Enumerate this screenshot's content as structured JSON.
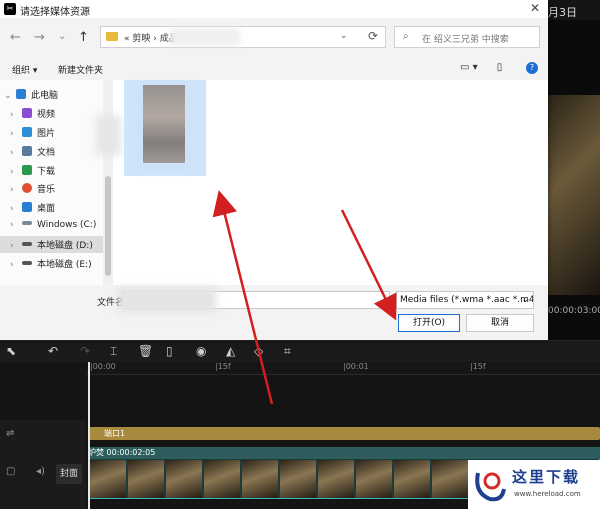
{
  "editor": {
    "date_label": "月3日",
    "timecode": "00:00:03:00",
    "ruler_ticks": [
      "|00:00",
      "|15f",
      "|00:01",
      "|15f"
    ],
    "text_clip_label": "端口1",
    "video_clip_label": "炉焚  00:00:02:05",
    "cover_label": "封面",
    "toolbar_icons": [
      "select-icon",
      "undo-icon",
      "redo-icon",
      "split-icon",
      "delete-icon",
      "crop-frame-icon",
      "play-circle-icon",
      "mirror-icon",
      "rotate-icon",
      "crop-icon"
    ]
  },
  "watermark": {
    "title": "这里下载",
    "url": "www.hereload.com"
  },
  "dialog": {
    "title": "请选择媒体资源",
    "close": "✕",
    "nav": {
      "back": "←",
      "forward": "→",
      "dropdown": "⌄",
      "up": "↑"
    },
    "breadcrumb": "«  剪映  ›  成品",
    "address_dropdown": "⌄",
    "refresh": "⟳",
    "search_placeholder": "在 绍义三兄弟 中搜索",
    "organize": "组织 ▾",
    "new_folder": "新建文件夹",
    "sidebar": [
      {
        "label": "此电脑",
        "chev": "⌄",
        "color": "#2a7fd4"
      },
      {
        "label": "视频",
        "chev": "›",
        "color": "#8a4fd1"
      },
      {
        "label": "图片",
        "chev": "›",
        "color": "#2a8fd4"
      },
      {
        "label": "文档",
        "chev": "›",
        "color": "#5a7a9a"
      },
      {
        "label": "下载",
        "chev": "›",
        "color": "#2a9a4a"
      },
      {
        "label": "音乐",
        "chev": "›",
        "color": "#e05030"
      },
      {
        "label": "桌面",
        "chev": "›",
        "color": "#2a7fd4"
      },
      {
        "label": "Windows (C:)",
        "chev": "›",
        "color": "#7a8a9a"
      },
      {
        "label": "本地磁盘 (D:)",
        "chev": "›",
        "color": "#555555"
      },
      {
        "label": "本地磁盘 (E:)",
        "chev": "›",
        "color": "#555555"
      }
    ],
    "file_name_label": "文件名",
    "file_type": "Media files (*.wma *.aac *.m4",
    "open_button": "打开(O)",
    "cancel_button": "取消",
    "accent_color": "#1f6fd1"
  }
}
